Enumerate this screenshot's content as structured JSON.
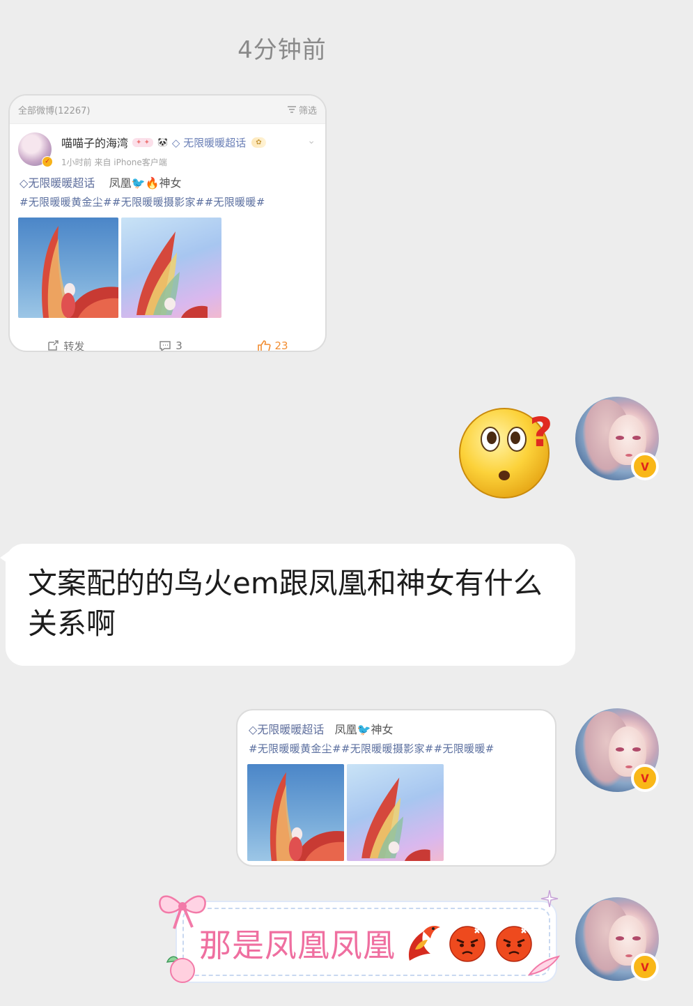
{
  "chat": {
    "timestamp": "4分钟前"
  },
  "shared_post": {
    "all_posts_label": "全部微博(12267)",
    "filter_label": "筛选",
    "author": "喵喵子的海湾",
    "supertopic_chip": "无限暖暖超话",
    "time_source": "1小时前  来自 iPhone客户端",
    "topic": "无限暖暖超话",
    "line_text_1": "凤凰",
    "line_text_2": "神女",
    "hashtags": "#无限暖暖黄金尘##无限暖暖摄影家##无限暖暖#",
    "actions": {
      "repost": "转发",
      "comments": "3",
      "likes": "23"
    }
  },
  "message_text": "文案配的的鸟火em跟凤凰和神女有什么关系啊",
  "repost_card": {
    "topic": "无限暖暖超话",
    "line_text_1": "凤凰",
    "line_text_2": "神女",
    "hashtags": "#无限暖暖黄金尘##无限暖暖摄影家##无限暖暖#"
  },
  "sticker_message": {
    "text": "那是凤凰凤凰"
  },
  "colors": {
    "background": "#ededed",
    "bubble": "#ffffff",
    "verified_badge": "#f9b718",
    "topic_blue": "#5b6f9f",
    "sticker_pink": "#ef6fa0",
    "like_orange": "#f28c30"
  },
  "icons": [
    "question-face-emoji",
    "phoenix-emoji",
    "angry-face-emoji",
    "verified-v-icon",
    "repost-icon",
    "comment-icon",
    "like-icon",
    "filter-icon",
    "chevron-down-icon",
    "bow-decoration",
    "peach-decoration",
    "sparkle-decoration"
  ]
}
